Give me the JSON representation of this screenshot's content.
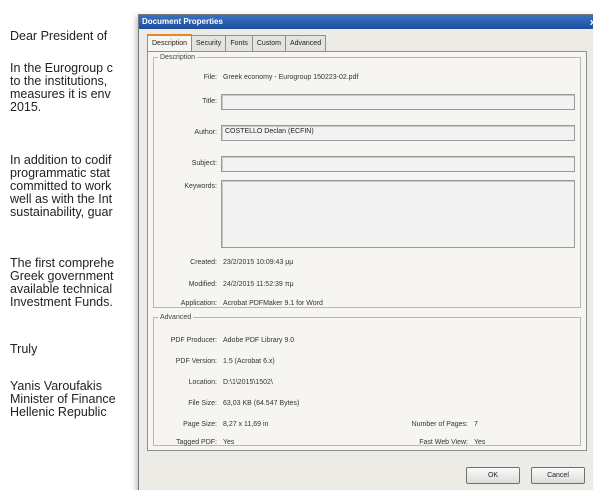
{
  "letter": {
    "salutation": "Dear President of",
    "p1": [
      "In the Eurogroup c",
      "to the institutions,",
      "measures it is env",
      "2015."
    ],
    "p2": [
      "In addition to codif",
      "programmatic stat",
      "committed to work",
      "well as with the Int",
      "sustainability, guar"
    ],
    "p3": [
      "The first comprehe",
      "Greek government",
      "available technical",
      "Investment Funds."
    ],
    "closing": "Truly",
    "signature": [
      "Yanis Varoufakis",
      "Minister of Finance",
      "Hellenic Republic"
    ]
  },
  "dialog": {
    "title": "Document Properties",
    "close_glyph": "x",
    "tabs": [
      "Description",
      "Security",
      "Fonts",
      "Custom",
      "Advanced"
    ],
    "active_tab": "Description",
    "description": {
      "legend": "Description",
      "file_label": "File:",
      "file_value": "Greek economy - Eurogroup 150223-02.pdf",
      "title_label": "Title:",
      "title_value": "",
      "author_label": "Author:",
      "author_value": "COSTELLO Declan (ECFIN)",
      "subject_label": "Subject:",
      "subject_value": "",
      "keywords_label": "Keywords:",
      "keywords_value": "",
      "created_label": "Created:",
      "created_value": "23/2/2015 10:09:43 μμ",
      "modified_label": "Modified:",
      "modified_value": "24/2/2015 11:52:39 πμ",
      "application_label": "Application:",
      "application_value": "Acrobat PDFMaker 9.1 for Word"
    },
    "advanced": {
      "legend": "Advanced",
      "producer_label": "PDF Producer:",
      "producer_value": "Adobe PDF Library 9.0",
      "version_label": "PDF Version:",
      "version_value": "1.5 (Acrobat 6.x)",
      "location_label": "Location:",
      "location_value": "D:\\1\\2015\\1502\\",
      "filesize_label": "File Size:",
      "filesize_value": "63,03 KB (64.547 Bytes)",
      "pagesize_label": "Page Size:",
      "pagesize_value": "8,27 x 11,69 in",
      "numpages_label": "Number of Pages:",
      "numpages_value": "7",
      "tagged_label": "Tagged PDF:",
      "tagged_value": "Yes",
      "fastweb_label": "Fast Web View:",
      "fastweb_value": "Yes"
    },
    "ok_label": "OK",
    "cancel_label": "Cancel"
  }
}
